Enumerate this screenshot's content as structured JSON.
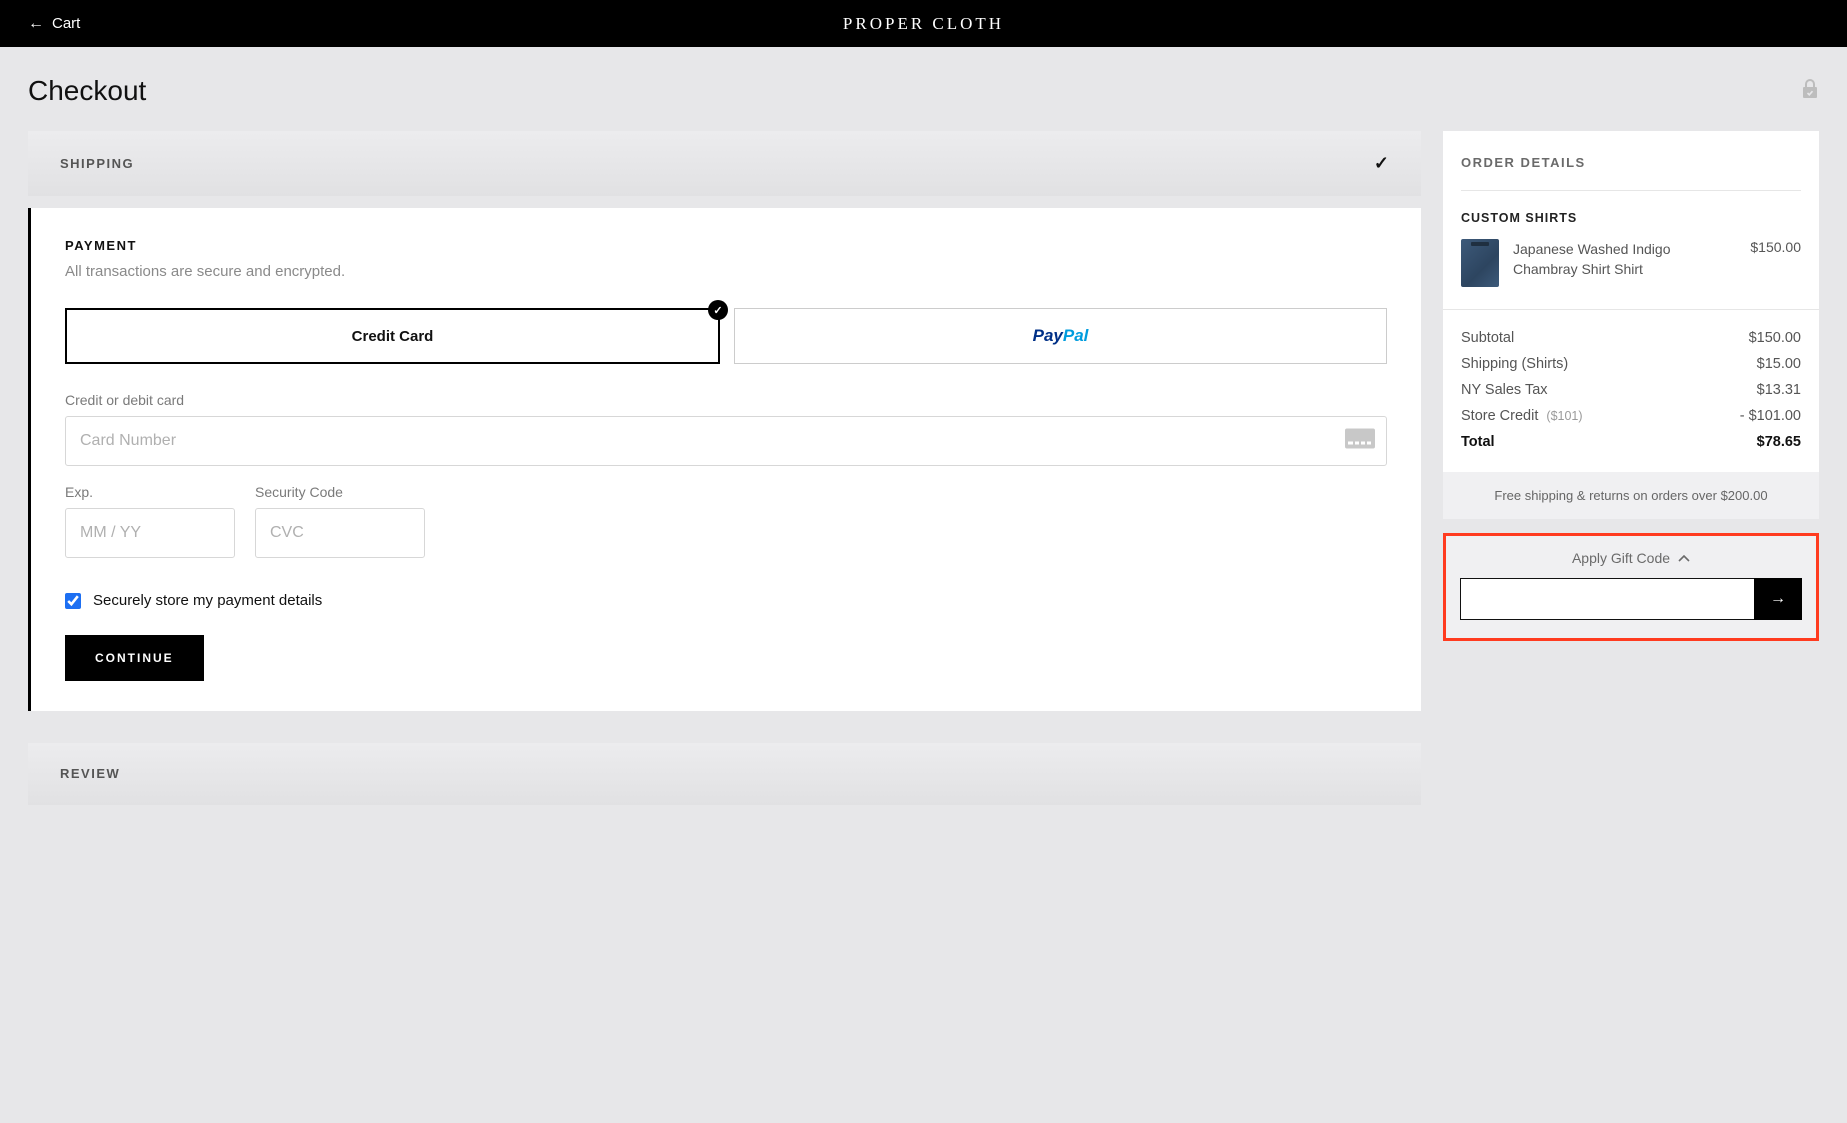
{
  "header": {
    "back_label": "Cart",
    "brand": "PROPER CLOTH"
  },
  "page_title": "Checkout",
  "steps": {
    "shipping": {
      "title": "SHIPPING"
    },
    "payment": {
      "title": "PAYMENT",
      "subtitle": "All transactions are secure and encrypted.",
      "methods": {
        "credit_card": "Credit Card"
      },
      "card_label": "Credit or debit card",
      "card_placeholder": "Card Number",
      "exp_label": "Exp.",
      "exp_placeholder": "MM / YY",
      "cvc_label": "Security Code",
      "cvc_placeholder": "CVC",
      "store_label": "Securely store my payment details",
      "continue_label": "CONTINUE"
    },
    "review": {
      "title": "REVIEW"
    }
  },
  "order": {
    "title": "ORDER DETAILS",
    "group_title": "CUSTOM SHIRTS",
    "items": [
      {
        "name": "Japanese Washed Indigo Chambray Shirt Shirt",
        "price": "$150.00"
      }
    ],
    "subtotal_label": "Subtotal",
    "subtotal": "$150.00",
    "shipping_label": "Shipping (Shirts)",
    "shipping": "$15.00",
    "tax_label": "NY Sales Tax",
    "tax": "$13.31",
    "credit_label": "Store Credit",
    "credit_note": "($101)",
    "credit": "- $101.00",
    "total_label": "Total",
    "total": "$78.65",
    "ship_note": "Free shipping & returns on orders over $200.00",
    "gift_label": "Apply Gift Code"
  }
}
